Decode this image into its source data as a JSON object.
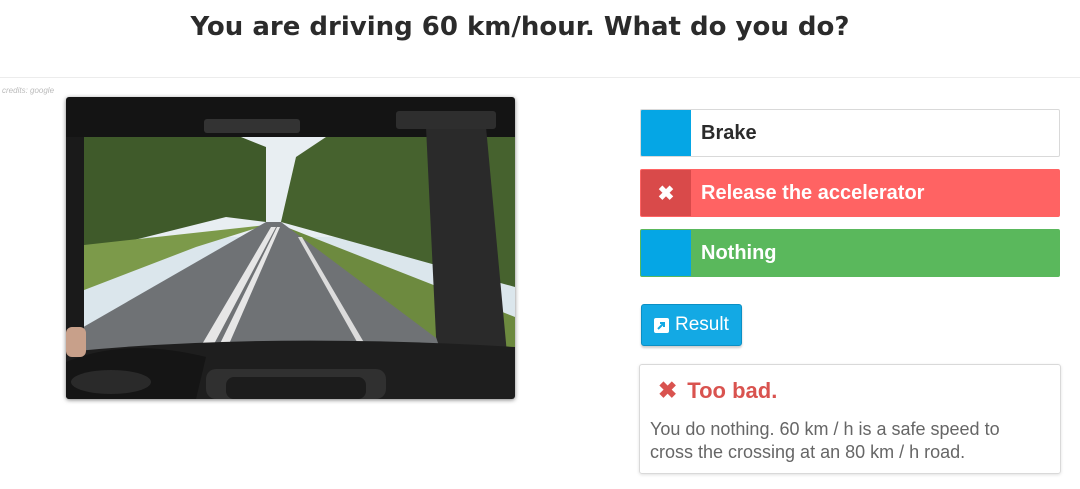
{
  "question": {
    "title": "You are driving 60 km/hour. What do you do?"
  },
  "image": {
    "credits": "credits: google"
  },
  "answers": [
    {
      "label": "Brake",
      "marker": "",
      "state": "neutral"
    },
    {
      "label": "Release the accelerator",
      "marker": "✖",
      "state": "wrong"
    },
    {
      "label": "Nothing",
      "marker": "",
      "state": "correct"
    }
  ],
  "result_button": {
    "label": "Result",
    "icon": "external-link-icon"
  },
  "feedback": {
    "icon": "cross-icon",
    "heading": "Too bad.",
    "text": "You do nothing. 60 km / h is a safe speed to cross the crossing at an 80 km / h road."
  },
  "colors": {
    "blue": "#05a6e5",
    "red": "#ff6363",
    "green": "#5ab85c",
    "error_text": "#d9534f"
  }
}
